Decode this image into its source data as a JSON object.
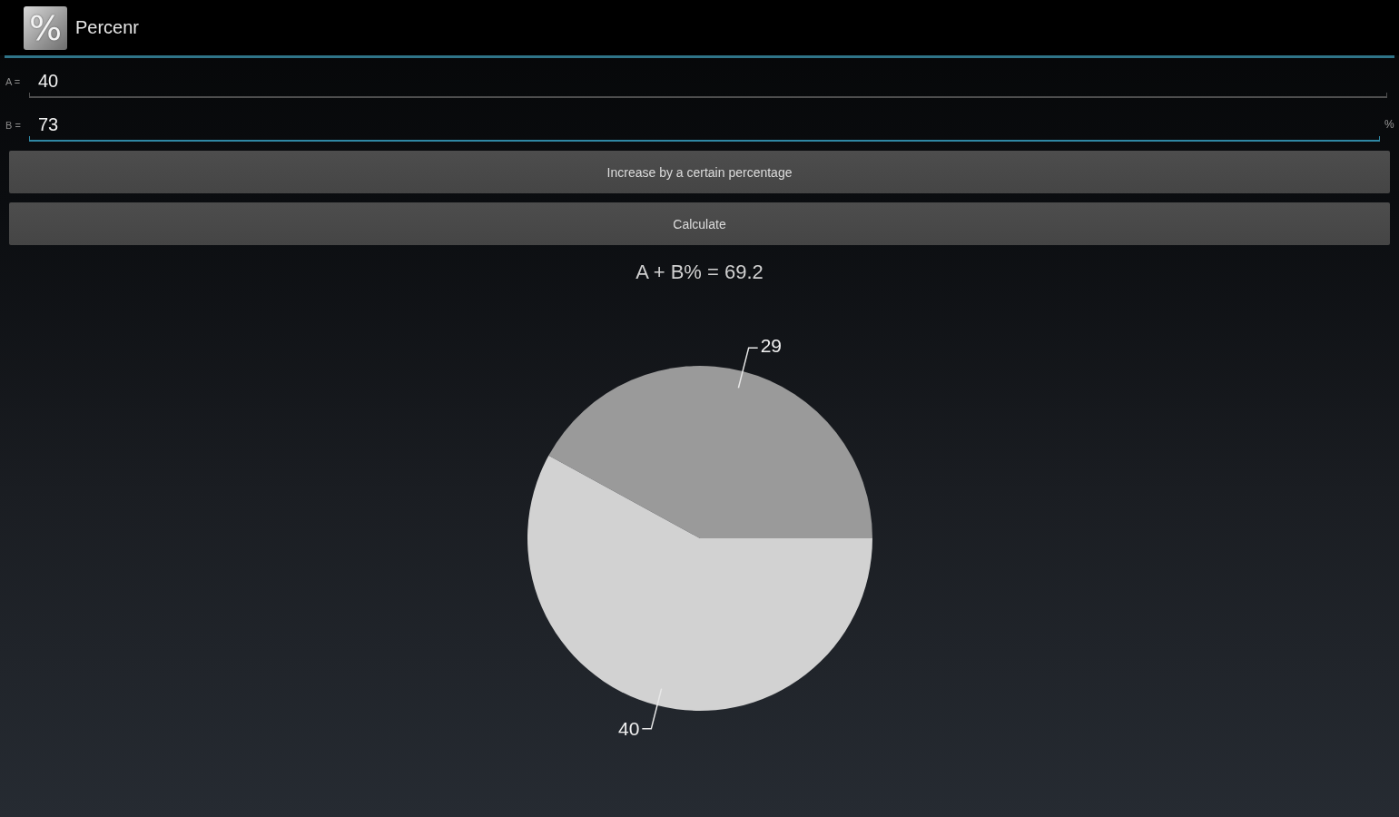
{
  "app_bar": {
    "logo": "%",
    "title": "Percenr"
  },
  "fields": [
    {
      "label": "A =",
      "value": "40",
      "focused": false
    },
    {
      "label": "B =",
      "value": "73",
      "focused": true,
      "suffix": "%"
    }
  ],
  "buttons": [
    {
      "label": "Increase by a certain percentage"
    },
    {
      "label": "Calculate"
    }
  ],
  "result": "A + B% = 69.2",
  "chart": {
    "chart_data": {
      "type": "pie",
      "values": [
        29,
        40
      ],
      "colors": [
        "#9a9a9a",
        "#d2d2d2"
      ],
      "data_labels": true
    }
  }
}
